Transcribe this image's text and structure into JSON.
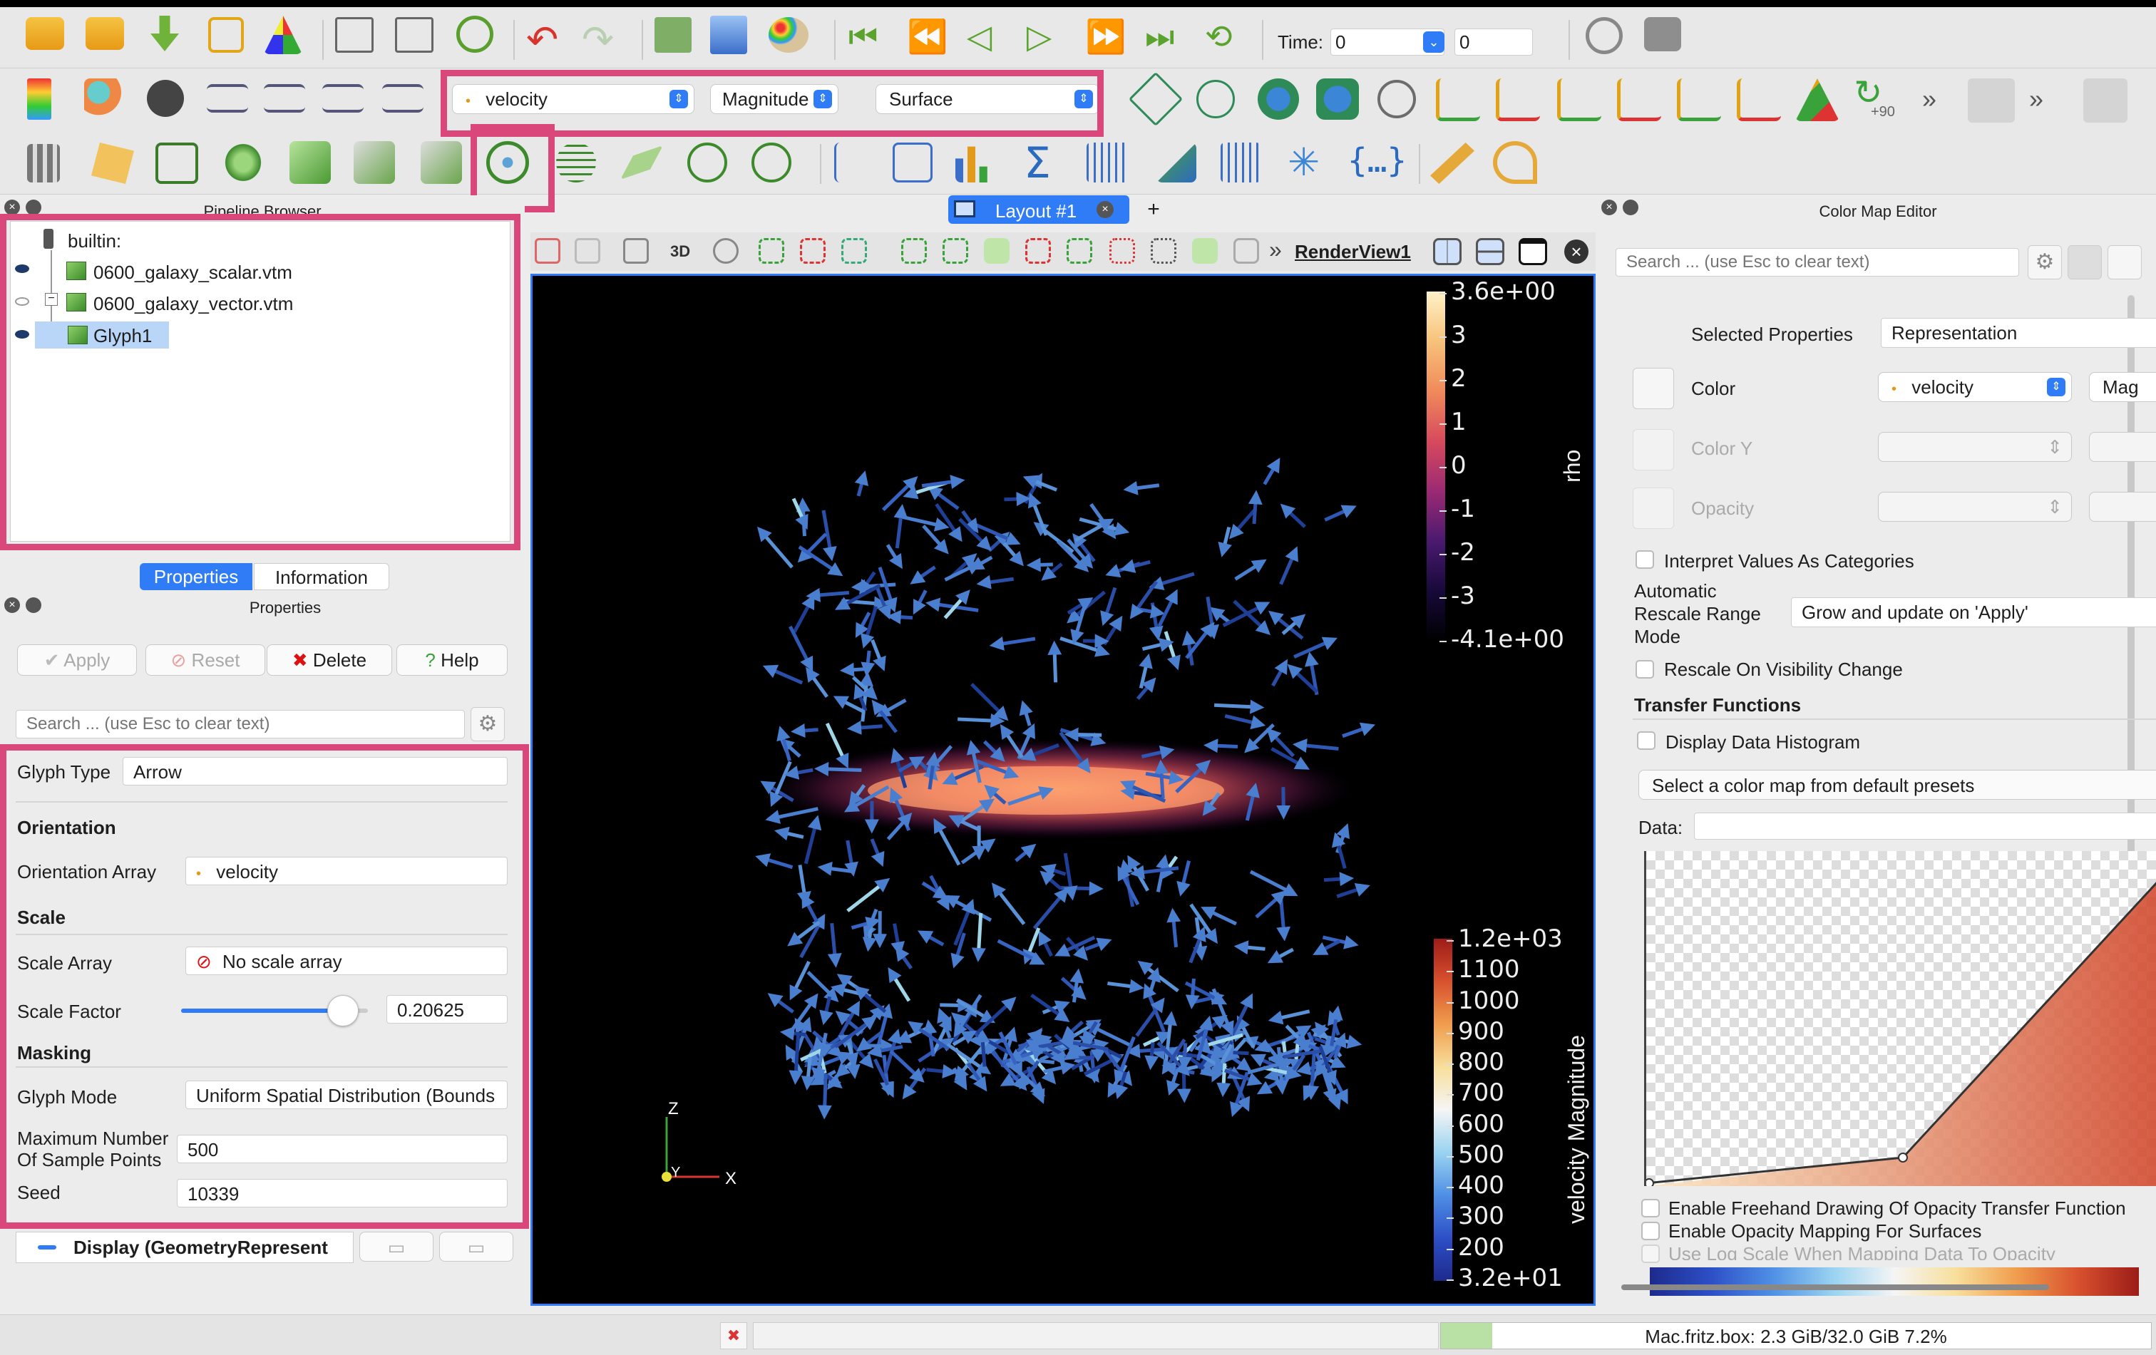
{
  "toolbar": {
    "time_label": "Time:",
    "time_value": "0",
    "time_index": "0",
    "array_combo": "velocity",
    "component_combo": "Magnitude",
    "representation_combo": "Surface",
    "overflow": "»",
    "rot_label": "+90"
  },
  "tabs": {
    "layout_tab": "Layout #1",
    "add_tab": "+"
  },
  "render_view": {
    "toolbar_3d": "3D",
    "view_name": "RenderView1",
    "more": "»"
  },
  "pipeline": {
    "title": "Pipeline Browser",
    "items": [
      {
        "label": "builtin:"
      },
      {
        "label": "0600_galaxy_scalar.vtm"
      },
      {
        "label": "0600_galaxy_vector.vtm"
      },
      {
        "label": "Glyph1"
      }
    ]
  },
  "properties_panel": {
    "tab_properties": "Properties",
    "tab_information": "Information",
    "title": "Properties",
    "apply": "Apply",
    "reset": "Reset",
    "delete": "Delete",
    "help": "Help",
    "search_placeholder": "Search ... (use Esc to clear text)",
    "glyph_type_label": "Glyph Type",
    "glyph_type_value": "Arrow",
    "orientation_section": "Orientation",
    "orientation_array_label": "Orientation Array",
    "orientation_array_value": "velocity",
    "scale_section": "Scale",
    "scale_array_label": "Scale Array",
    "scale_array_value": "No scale array",
    "scale_factor_label": "Scale Factor",
    "scale_factor_value": "0.20625",
    "scale_factor_fraction": 0.93,
    "masking_section": "Masking",
    "glyph_mode_label": "Glyph Mode",
    "glyph_mode_value": "Uniform Spatial Distribution (Bounds",
    "max_points_label_1": "Maximum Number",
    "max_points_label_2": "Of Sample Points",
    "max_points_value": "500",
    "seed_label": "Seed",
    "seed_value": "10339",
    "display_section": "Display (GeometryRepresent"
  },
  "colorbar_rho": {
    "title": "rho",
    "ticks": [
      "3.6e+00",
      "3",
      "2",
      "1",
      "0",
      "-1",
      "-2",
      "-3",
      "-4.1e+00"
    ]
  },
  "colorbar_velocity": {
    "title": "velocity Magnitude",
    "ticks": [
      "1.2e+03",
      "1100",
      "1000",
      "900",
      "800",
      "700",
      "600",
      "500",
      "400",
      "300",
      "200",
      "3.2e+01"
    ]
  },
  "axes": {
    "x": "X",
    "y": "Y",
    "z": "Z"
  },
  "color_map_editor": {
    "title": "Color Map Editor",
    "search_placeholder": "Search ... (use Esc to clear text)",
    "selected_properties_label": "Selected Properties",
    "selected_properties_value": "Representation",
    "color_label": "Color",
    "color_value": "velocity",
    "color_component": "Mag",
    "color_y_label": "Color Y",
    "opacity_label": "Opacity",
    "interpret_categories": "Interpret Values As Categories",
    "rescale_label_1": "Automatic",
    "rescale_label_2": "Rescale Range",
    "rescale_label_3": "Mode",
    "rescale_value": "Grow and update on 'Apply'",
    "rescale_visibility": "Rescale On Visibility Change",
    "transfer_functions": "Transfer Functions",
    "display_histogram": "Display Data Histogram",
    "preset_button": "Select a color map from default presets",
    "data_label": "Data:",
    "freehand": "Enable Freehand Drawing Of Opacity Transfer Function",
    "opacity_surfaces": "Enable Opacity Mapping For Surfaces",
    "log_scale": "Use Log Scale When Mapping Data To Opacity"
  },
  "status_bar": {
    "memory": "Mac.fritz.box: 2.3 GiB/32.0 GiB 7.2%"
  },
  "colors": {
    "accent": "#2f7cf6",
    "highlight": "#d9477b",
    "selection": "#b9d5f7"
  }
}
